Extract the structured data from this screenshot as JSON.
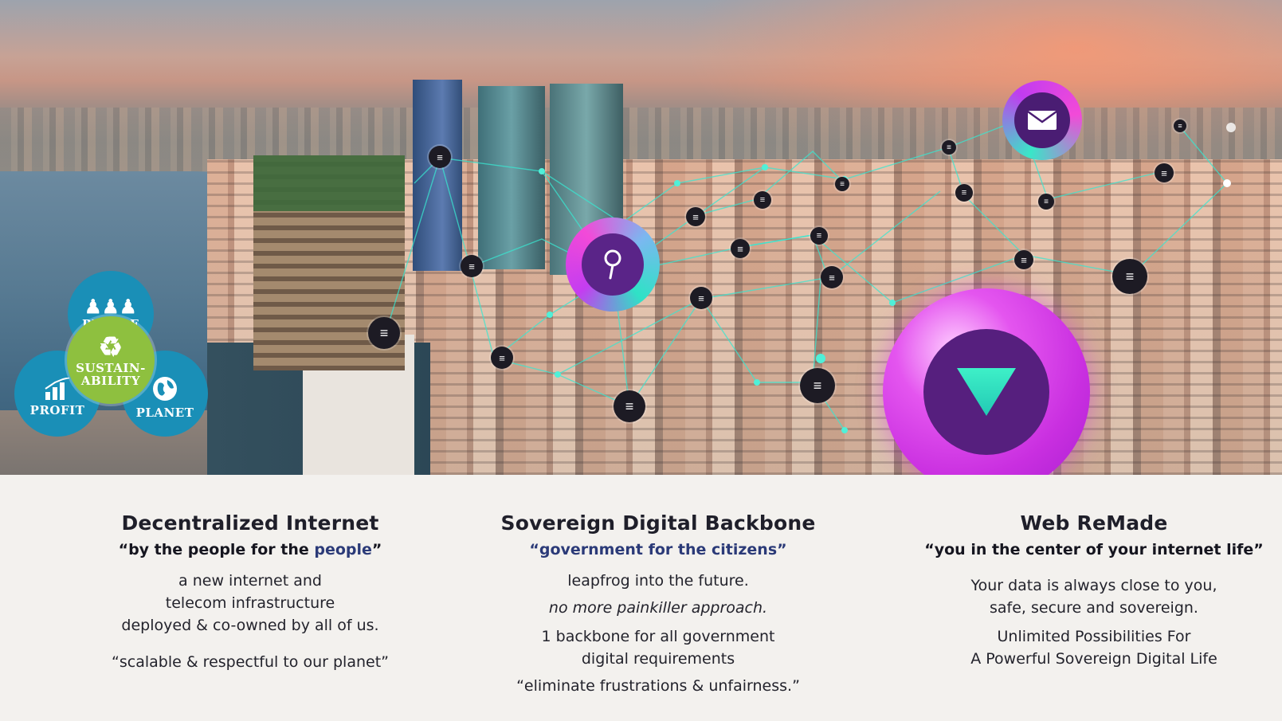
{
  "colors": {
    "emblem_blue": "#1a8fb7",
    "emblem_green": "#8ec03f",
    "orb_magenta": "#d23ce6",
    "orb_inner": "#561f7e",
    "teal_accent": "#2fe2c6",
    "subtitle_accent": "#2b3a78"
  },
  "hero": {
    "emblem": {
      "people": "PEOPLE",
      "profit": "PROFIT",
      "planet": "PLANET",
      "center_line1": "SUSTAIN-",
      "center_line2": "ABILITY"
    },
    "node_glyph": "≡",
    "icons": {
      "mail": "envelope-icon",
      "search": "search-icon",
      "play": "play-triangle-icon"
    }
  },
  "features": [
    {
      "title": "Decentralized Internet",
      "subtitle_prefix": "“by the people for the ",
      "subtitle_accent": "people",
      "subtitle_suffix": "”",
      "line1": "a new internet and",
      "line2": "telecom infrastructure",
      "line3": "deployed & co-owned by all of us.",
      "quote": "“scalable & respectful to our planet”"
    },
    {
      "title": "Sovereign Digital Backbone",
      "subtitle": "“government for the citizens”",
      "line1": "leapfrog into the future.",
      "italic_line": "no more painkiller approach.",
      "line2": "1 backbone for all government",
      "line3": "digital requirements",
      "quote": "“eliminate frustrations & unfairness.”"
    },
    {
      "title": "Web ReMade",
      "subtitle": "“you in the center of your internet life”",
      "line1": "Your data is always close to you,",
      "line2": "safe, secure and sovereign.",
      "line3": "Unlimited Possibilities For",
      "line4": "A Powerful Sovereign Digital Life"
    }
  ]
}
